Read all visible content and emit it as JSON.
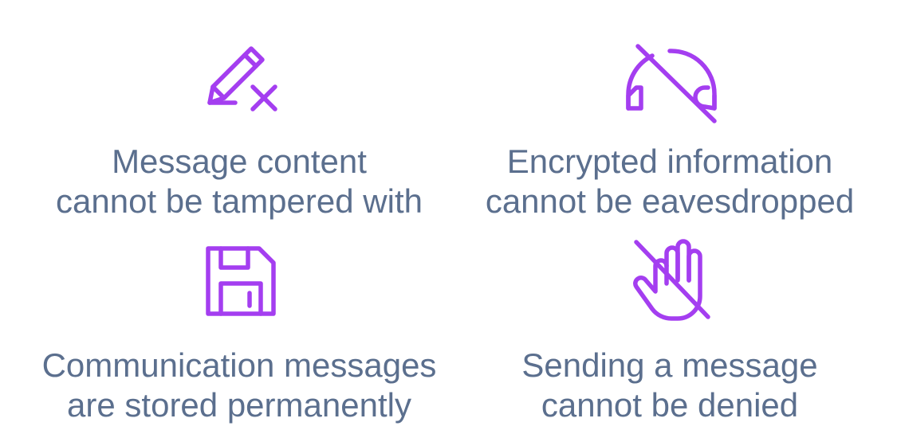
{
  "colors": {
    "accent": "#a43ef0",
    "text": "#5b6f8e",
    "background": "#ffffff"
  },
  "features": [
    {
      "icon": "pencil-x-icon",
      "line1": "Message content",
      "line2": "cannot be tampered with"
    },
    {
      "icon": "headphones-off-icon",
      "line1": "Encrypted information",
      "line2": "cannot be eavesdropped"
    },
    {
      "icon": "floppy-disk-icon",
      "line1": "Communication messages",
      "line2": "are stored permanently"
    },
    {
      "icon": "hand-off-icon",
      "line1": "Sending a message",
      "line2": "cannot be  denied"
    }
  ]
}
